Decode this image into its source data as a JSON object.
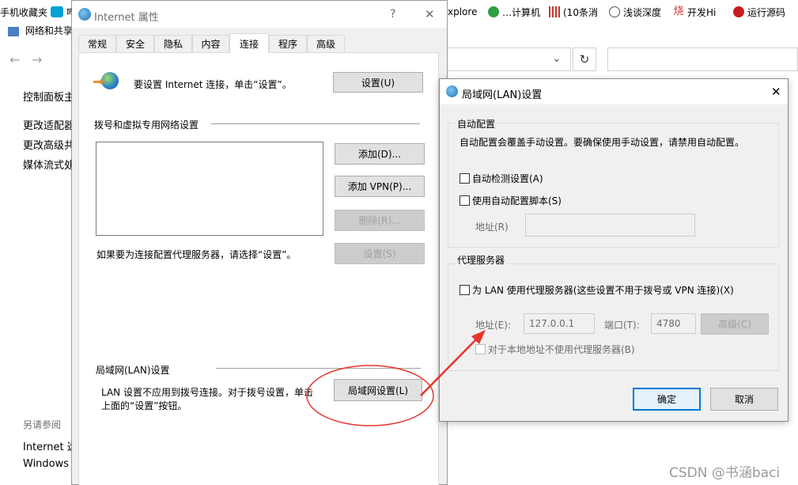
{
  "bookmarks": [
    {
      "label": "手机收藏夹",
      "icon": "folder-icon"
    },
    {
      "label": "哔",
      "icon": "bilibili-icon"
    },
    {
      "label": "xplore",
      "icon": "page-icon"
    },
    {
      "label": "…计算机",
      "icon": "in-icon"
    },
    {
      "label": "(10条消",
      "icon": "csdn-icon"
    },
    {
      "label": "浅谈深度",
      "icon": "globe-icon"
    },
    {
      "label": "开发Hi",
      "icon": "flame-icon"
    },
    {
      "label": "运行源码",
      "icon": "gitee-icon"
    }
  ],
  "explorer": {
    "path_title": "网络和共享",
    "sidebar": [
      "控制面板主",
      "更改适配器",
      "更改高级共",
      "媒体流式处"
    ],
    "see_also_title": "另请参阅",
    "see_also": [
      "Internet 选",
      "Windows D"
    ]
  },
  "internet_props": {
    "title": "Internet 属性",
    "help": "?",
    "close": "✕",
    "tabs": [
      "常规",
      "安全",
      "隐私",
      "内容",
      "连接",
      "程序",
      "高级"
    ],
    "active_tab": 4,
    "setup_text": "要设置 Internet 连接，单击“设置”。",
    "setup_button": "设置(U)",
    "dialup_title": "拨号和虚拟专用网络设置",
    "add_button": "添加(D)...",
    "add_vpn_button": "添加 VPN(P)...",
    "remove_button": "删除(R)...",
    "proxy_hint": "如果要为连接配置代理服务器，请选择“设置”。",
    "settings_button": "设置(S)",
    "lan_title": "局域网(LAN)设置",
    "lan_desc_1": "LAN 设置不应用到拨号连接。对于拨号设置，单击",
    "lan_desc_2": "上面的“设置”按钮。",
    "lan_button": "局域网设置(L)"
  },
  "lan_dialog": {
    "title": "局域网(LAN)设置",
    "close": "✕",
    "auto_group": "自动配置",
    "auto_desc": "自动配置会覆盖手动设置。要确保使用手动设置，请禁用自动配置。",
    "auto_detect": "自动检测设置(A)",
    "auto_script": "使用自动配置脚本(S)",
    "address_label": "地址(R)",
    "address_value": "",
    "proxy_group": "代理服务器",
    "use_proxy": "为 LAN 使用代理服务器(这些设置不用于拨号或 VPN 连接)(X)",
    "proxy_address_label": "地址(E):",
    "proxy_address_value": "127.0.0.1",
    "port_label": "端口(T):",
    "port_value": "4780",
    "advanced_button": "高级(C)",
    "bypass_local": "对于本地地址不使用代理服务器(B)",
    "ok_button": "确定",
    "cancel_button": "取消"
  },
  "browser": {
    "dropdown": "⌄",
    "refresh": "↻"
  },
  "watermark": "CSDN @书涵baci",
  "colors": {
    "annotation": "#e8332b",
    "accent": "#0078d7"
  }
}
